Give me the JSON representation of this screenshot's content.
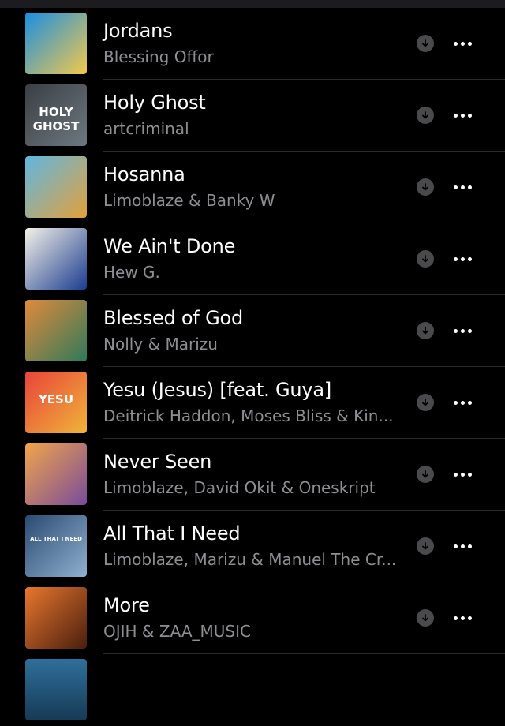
{
  "songs": [
    {
      "title": "Jordans",
      "artist": "Blessing Offor",
      "art_colors": [
        "#1a8fe0",
        "#f2c94c"
      ],
      "art_text": ""
    },
    {
      "title": "Holy Ghost",
      "artist": "artcriminal",
      "art_colors": [
        "#3a3f44",
        "#6d7880"
      ],
      "art_text": "HOLY GHOST"
    },
    {
      "title": "Hosanna",
      "artist": "Limoblaze & Banky W",
      "art_colors": [
        "#5fb7e0",
        "#e3a13b"
      ],
      "art_text": ""
    },
    {
      "title": "We Ain't Done",
      "artist": "Hew G.",
      "art_colors": [
        "#f4f1e8",
        "#1b3c8f"
      ],
      "art_text": ""
    },
    {
      "title": "Blessed of God",
      "artist": "Nolly & Marizu",
      "art_colors": [
        "#e08a3c",
        "#2f7a5a"
      ],
      "art_text": ""
    },
    {
      "title": "Yesu (Jesus) [feat. Guya]",
      "artist": "Deitrick Haddon, Moses Bliss & Kin...",
      "art_colors": [
        "#e8443a",
        "#f0b43a"
      ],
      "art_text": "YESU"
    },
    {
      "title": "Never Seen",
      "artist": "Limoblaze, David Okit & Oneskript",
      "art_colors": [
        "#f0a54a",
        "#7a4b9a"
      ],
      "art_text": ""
    },
    {
      "title": "All That I Need",
      "artist": "Limoblaze, Marizu & Manuel The Cr...",
      "art_colors": [
        "#2b4a72",
        "#8fb0cf"
      ],
      "art_text": "ALL THAT I NEED"
    },
    {
      "title": "More",
      "artist": "OJIH & ZAA_MUSIC",
      "art_colors": [
        "#e8772e",
        "#4a1e0e"
      ],
      "art_text": ""
    }
  ]
}
